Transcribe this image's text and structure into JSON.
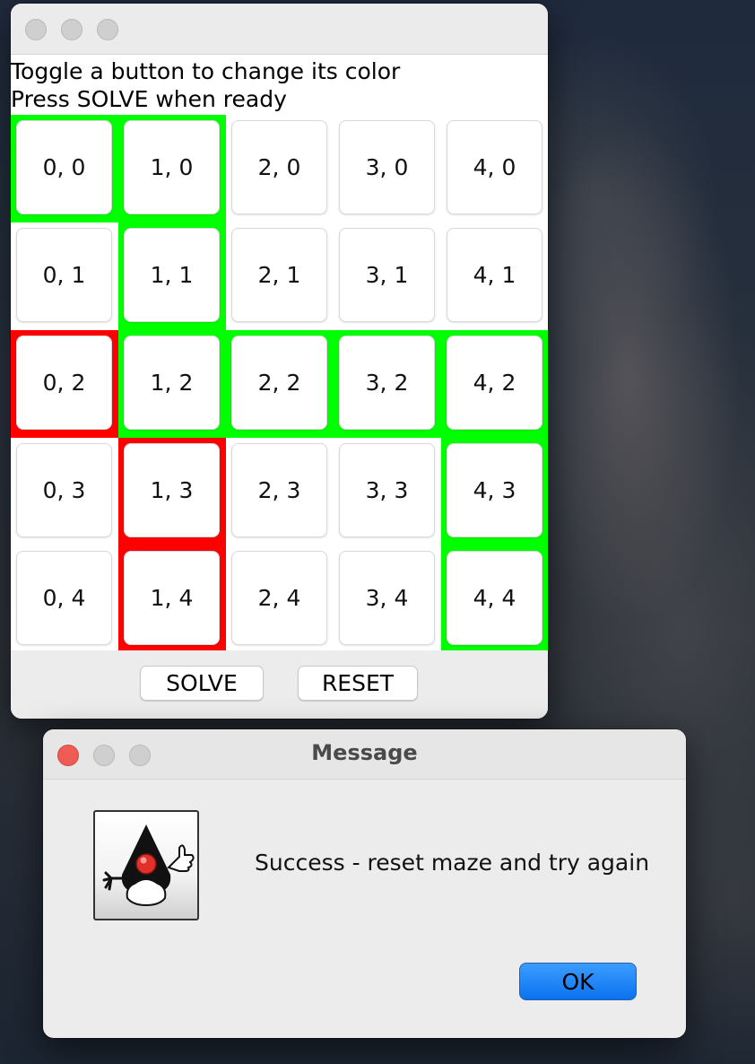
{
  "main_window": {
    "instructions": [
      "Toggle a button to change its color",
      "Press SOLVE when ready"
    ],
    "grid": {
      "columns": 5,
      "rows": 5,
      "colors": {
        "green": "#00ff00",
        "red": "#ff0000",
        "none": "#ffffff"
      },
      "cells": [
        {
          "label": "0, 0",
          "color": "green"
        },
        {
          "label": "1, 0",
          "color": "green"
        },
        {
          "label": "2, 0",
          "color": "none"
        },
        {
          "label": "3, 0",
          "color": "none"
        },
        {
          "label": "4, 0",
          "color": "none"
        },
        {
          "label": "0, 1",
          "color": "none"
        },
        {
          "label": "1, 1",
          "color": "green"
        },
        {
          "label": "2, 1",
          "color": "none"
        },
        {
          "label": "3, 1",
          "color": "none"
        },
        {
          "label": "4, 1",
          "color": "none"
        },
        {
          "label": "0, 2",
          "color": "red"
        },
        {
          "label": "1, 2",
          "color": "green"
        },
        {
          "label": "2, 2",
          "color": "green"
        },
        {
          "label": "3, 2",
          "color": "green"
        },
        {
          "label": "4, 2",
          "color": "green"
        },
        {
          "label": "0, 3",
          "color": "none"
        },
        {
          "label": "1, 3",
          "color": "red"
        },
        {
          "label": "2, 3",
          "color": "none"
        },
        {
          "label": "3, 3",
          "color": "none"
        },
        {
          "label": "4, 3",
          "color": "green"
        },
        {
          "label": "0, 4",
          "color": "none"
        },
        {
          "label": "1, 4",
          "color": "red"
        },
        {
          "label": "2, 4",
          "color": "none"
        },
        {
          "label": "3, 4",
          "color": "none"
        },
        {
          "label": "4, 4",
          "color": "green"
        }
      ]
    },
    "buttons": {
      "solve": "SOLVE",
      "reset": "RESET"
    }
  },
  "message_dialog": {
    "title": "Message",
    "text": "Success - reset maze and try again",
    "ok": "OK",
    "icon": "java-duke-icon"
  }
}
